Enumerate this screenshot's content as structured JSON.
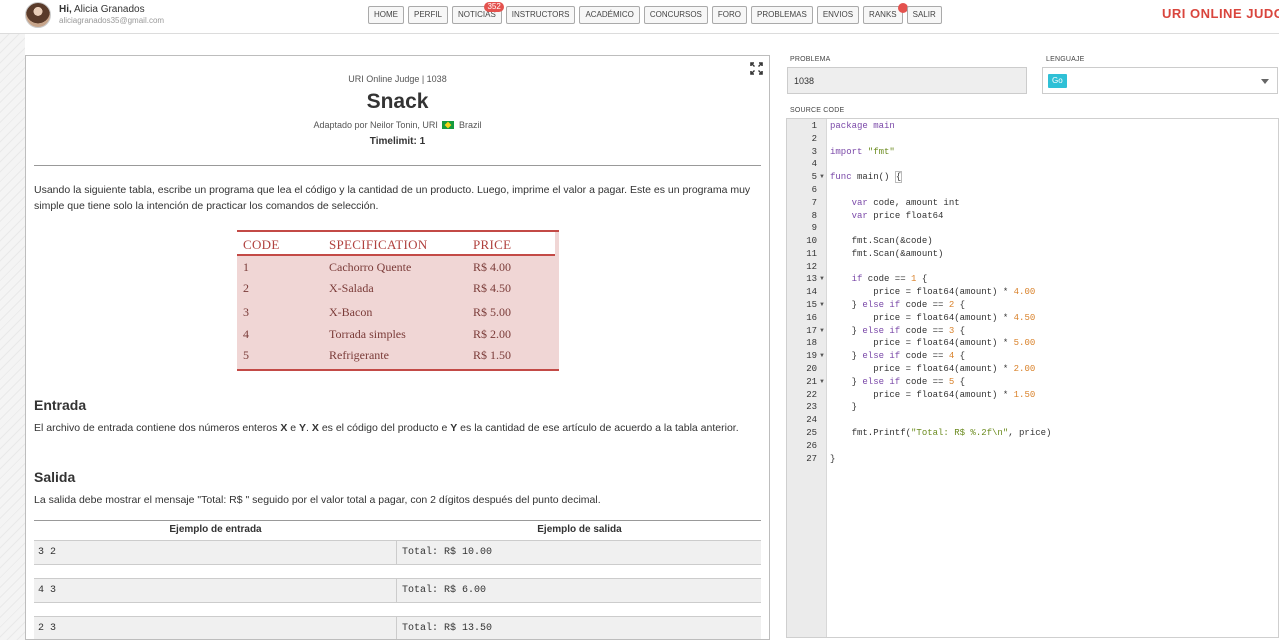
{
  "user": {
    "greeting": "Hi,",
    "name": "Alicia Granados",
    "email": "aliciagranados35@gmail.com"
  },
  "nav": [
    {
      "label": "HOME"
    },
    {
      "label": "PERFIL"
    },
    {
      "label": "NOTICIAS",
      "badge": "352"
    },
    {
      "label": "INSTRUCTORS"
    },
    {
      "label": "ACADÉMICO"
    },
    {
      "label": "CONCURSOS"
    },
    {
      "label": "FORO"
    },
    {
      "label": "PROBLEMAS"
    },
    {
      "label": "ENVIOS"
    },
    {
      "label": "RANKS"
    },
    {
      "label": "SALIR"
    }
  ],
  "brand": "URI ONLINE JUDG",
  "problem": {
    "source": "URI Online Judge | 1038",
    "title": "Snack",
    "adapted_prefix": "Adaptado por Neilor Tonin, URI",
    "country": "Brazil",
    "timelimit": "Timelimit: 1",
    "description": "Usando la siguiente tabla, escribe un programa que lea el código y la cantidad de un producto. Luego, imprime el valor a pagar. Este es un programa muy simple que tiene solo la intención de practicar los comandos de selección.",
    "table": {
      "headers": [
        "CODE",
        "SPECIFICATION",
        "PRICE"
      ],
      "rows": [
        [
          "1",
          "Cachorro Quente",
          "R$ 4.00"
        ],
        [
          "2",
          "X-Salada",
          "R$ 4.50"
        ],
        [
          "3",
          "X-Bacon",
          "R$ 5.00"
        ],
        [
          "4",
          "Torrada simples",
          "R$ 2.00"
        ],
        [
          "5",
          "Refrigerante",
          "R$ 1.50"
        ]
      ]
    },
    "input_title": "Entrada",
    "input_text": {
      "a": "El archivo de entrada contiene dos números enteros ",
      "x": "X",
      "b": " e ",
      "y": "Y",
      "c": ". ",
      "x2": "X",
      "d": " es el código del producto e ",
      "y2": "Y",
      "e": " es la cantidad de ese artículo de acuerdo a la tabla anterior."
    },
    "output_title": "Salida",
    "output_text": "La salida debe mostrar el mensaje \"Total: R$ \" seguido por el valor total a pagar, con 2 dígitos después del punto decimal.",
    "samples_head": {
      "input": "Ejemplo de entrada",
      "output": "Ejemplo de salida"
    },
    "samples": [
      {
        "input": "3 2",
        "output": "Total: R$ 10.00"
      },
      {
        "input": "4 3",
        "output": "Total: R$ 6.00"
      },
      {
        "input": "2 3",
        "output": "Total: R$ 13.50"
      }
    ]
  },
  "form": {
    "problem_label": "PROBLEMA",
    "problem_value": "1038",
    "language_label": "LENGUAJE",
    "language_value": "Go",
    "source_label": "SOURCE CODE"
  },
  "line_numbers": [
    "1",
    "2",
    "3",
    "4",
    "5",
    "6",
    "7",
    "8",
    "9",
    "10",
    "11",
    "12",
    "13",
    "14",
    "15",
    "16",
    "17",
    "18",
    "19",
    "20",
    "21",
    "22",
    "23",
    "24",
    "25",
    "26",
    "27"
  ],
  "code": {
    "l1": "package main",
    "l3a": "import ",
    "l3b": "\"fmt\"",
    "l5a": "func",
    "l5b": " main() ",
    "l5c": "{",
    "l7a": "    var",
    "l7b": " code, amount int",
    "l8a": "    var",
    "l8b": " price float64",
    "l10": "    fmt.Scan(&code)",
    "l11": "    fmt.Scan(&amount)",
    "l13a": "    if",
    "l13b": " code == ",
    "l13c": "1",
    "l13d": " {",
    "l14a": "        price = float64(amount) * ",
    "l14b": "4.00",
    "l15a": "    } ",
    "l15b": "else if",
    "l15c": " code == ",
    "l15d": "2",
    "l15e": " {",
    "l16a": "        price = float64(amount) * ",
    "l16b": "4.50",
    "l17a": "    } ",
    "l17b": "else if",
    "l17c": " code == ",
    "l17d": "3",
    "l17e": " {",
    "l18a": "        price = float64(amount) * ",
    "l18b": "5.00",
    "l19a": "    } ",
    "l19b": "else if",
    "l19c": " code == ",
    "l19d": "4",
    "l19e": " {",
    "l20a": "        price = float64(amount) * ",
    "l20b": "2.00",
    "l21a": "    } ",
    "l21b": "else if",
    "l21c": " code == ",
    "l21d": "5",
    "l21e": " {",
    "l22a": "        price = float64(amount) * ",
    "l22b": "1.50",
    "l23": "    }",
    "l25a": "    fmt.Printf(",
    "l25b": "\"Total: R$ %.2f\\n\"",
    "l25c": ", price)",
    "l27": "}"
  },
  "icons": {
    "expand": "expand-icon",
    "dropdown": "chevron-down-icon",
    "fold": "fold-arrow-icon"
  },
  "colors": {
    "brand": "#d9453d",
    "badge": "#e4524e",
    "language_chip": "#2fc0d6",
    "table_accent": "#c34a46",
    "table_fill": "#f0d6d5"
  }
}
